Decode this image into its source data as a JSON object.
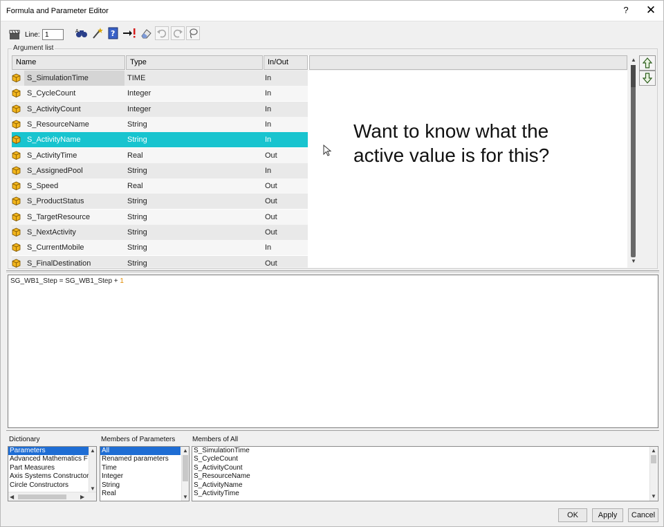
{
  "window": {
    "title": "Formula and Parameter Editor",
    "help_glyph": "?",
    "close_glyph": "✕"
  },
  "toolbar": {
    "line_label": "Line:",
    "line_value": "1"
  },
  "argument_list": {
    "group_label": "Argument list",
    "columns": [
      "Name",
      "Type",
      "In/Out"
    ],
    "rows": [
      {
        "name": "S_SimulationTime",
        "type": "TIME",
        "io": "In"
      },
      {
        "name": "S_CycleCount",
        "type": "Integer",
        "io": "In"
      },
      {
        "name": "S_ActivityCount",
        "type": "Integer",
        "io": "In"
      },
      {
        "name": "S_ResourceName",
        "type": "String",
        "io": "In"
      },
      {
        "name": "S_ActivityName",
        "type": "String",
        "io": "In"
      },
      {
        "name": "S_ActivityTime",
        "type": "Real",
        "io": "Out"
      },
      {
        "name": "S_AssignedPool",
        "type": "String",
        "io": "In"
      },
      {
        "name": "S_Speed",
        "type": "Real",
        "io": "Out"
      },
      {
        "name": "S_ProductStatus",
        "type": "String",
        "io": "Out"
      },
      {
        "name": "S_TargetResource",
        "type": "String",
        "io": "Out"
      },
      {
        "name": "S_NextActivity",
        "type": "String",
        "io": "Out"
      },
      {
        "name": "S_CurrentMobile",
        "type": "String",
        "io": "In"
      },
      {
        "name": "S_FinalDestination",
        "type": "String",
        "io": "Out"
      }
    ],
    "selected_index": 4
  },
  "annotation": {
    "line1": "Want to know what the",
    "line2": "active value is for this?"
  },
  "formula": {
    "text": "SG_WB1_Step = SG_WB1_Step + ",
    "number": "1"
  },
  "dictionary": {
    "label": "Dictionary",
    "items": [
      "Parameters",
      "Advanced Mathematics F",
      "Part Measures",
      "Axis Systems Constructor",
      "Circle Constructors"
    ],
    "selected_index": 0
  },
  "members_of_parameters": {
    "label": "Members of Parameters",
    "items": [
      "All",
      "Renamed parameters",
      "Time",
      "Integer",
      "String",
      "Real"
    ],
    "selected_index": 0
  },
  "members_of_all": {
    "label": "Members of All",
    "items": [
      "S_SimulationTime",
      "S_CycleCount",
      "S_ActivityCount",
      "S_ResourceName",
      "S_ActivityName",
      "S_ActivityTime"
    ]
  },
  "buttons": {
    "ok": "OK",
    "apply": "Apply",
    "cancel": "Cancel"
  },
  "colors": {
    "selection": "#18c4cf",
    "list_selection": "#1e6dd4",
    "cube_icon": "#f2b51c"
  }
}
